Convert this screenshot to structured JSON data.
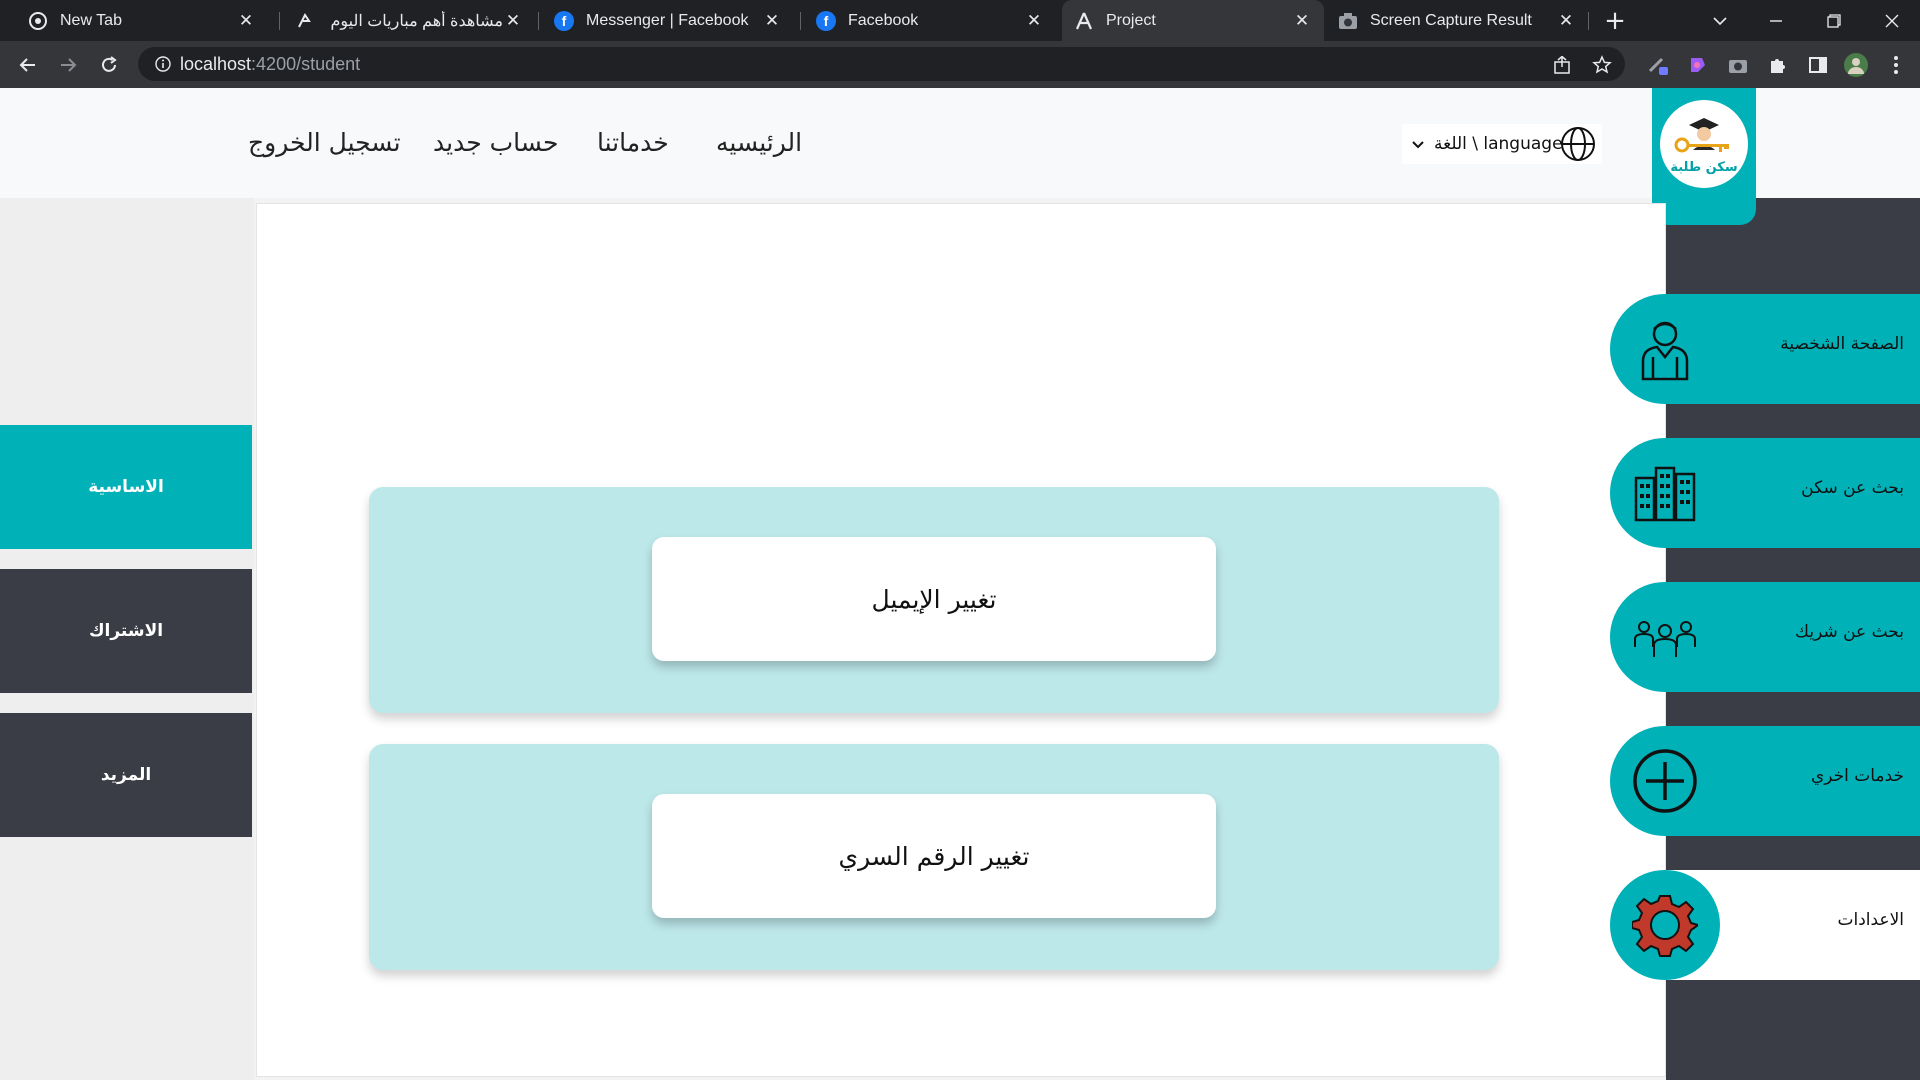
{
  "browser": {
    "tabs": [
      {
        "title": "New Tab",
        "icon": "chrome-icon"
      },
      {
        "title": "مشاهدة أهم مباريات اليوم | أ",
        "icon": "soccer-site-icon"
      },
      {
        "title": "Messenger | Facebook",
        "icon": "facebook-icon"
      },
      {
        "title": "Facebook",
        "icon": "facebook-icon"
      },
      {
        "title": "Project",
        "icon": "angular-icon"
      },
      {
        "title": "Screen Capture Result",
        "icon": "camera-icon"
      }
    ],
    "active_tab": 4,
    "new_tab_label": "+",
    "url_host": "localhost",
    "url_path": ":4200/student"
  },
  "navbar": {
    "links": [
      "الرئيسيه",
      "خدماتنا",
      "حساب جديد",
      "تسجيل الخروج"
    ],
    "language_label": "اللغة \\ language",
    "logo_text": "سكن طلبة"
  },
  "right_sidebar": {
    "items": [
      {
        "label": "الصفحة الشخصية",
        "icon": "student-profile-icon"
      },
      {
        "label": "بحث عن سكن",
        "icon": "buildings-icon"
      },
      {
        "label": "بحث عن شريك",
        "icon": "group-people-icon"
      },
      {
        "label": "خدمات اخري",
        "icon": "plus-circle-icon"
      },
      {
        "label": "الاعدادات",
        "icon": "gear-icon"
      }
    ]
  },
  "left_sidebar": {
    "items": [
      {
        "label": "الاساسية",
        "active": true
      },
      {
        "label": "الاشتراك",
        "active": false
      },
      {
        "label": "المزيد",
        "active": false
      }
    ]
  },
  "main": {
    "cards": [
      {
        "button_label": "تغيير الإيميل"
      },
      {
        "button_label": "تغيير الرقم السري"
      }
    ]
  },
  "colors": {
    "accent": "#00b2b8",
    "card_bg": "#bde8ea",
    "dark": "#3a3d45"
  }
}
